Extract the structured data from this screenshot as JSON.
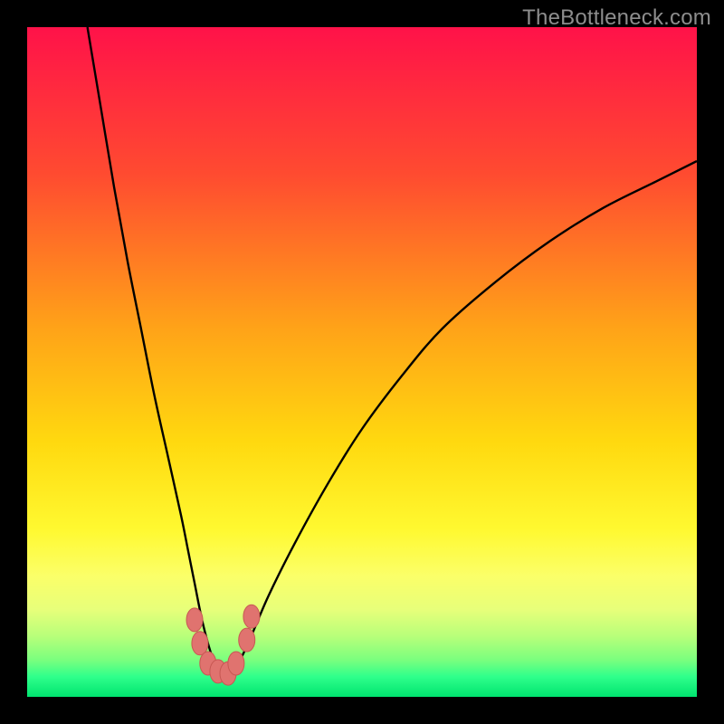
{
  "watermark": "TheBottleneck.com",
  "colors": {
    "frame": "#000000",
    "curve_stroke": "#000000",
    "marker_fill": "#e0736f",
    "marker_stroke": "#c75853",
    "gradient_stops": [
      {
        "offset": 0.0,
        "color": "#ff1249"
      },
      {
        "offset": 0.22,
        "color": "#ff4b30"
      },
      {
        "offset": 0.45,
        "color": "#ffa318"
      },
      {
        "offset": 0.62,
        "color": "#ffd90f"
      },
      {
        "offset": 0.75,
        "color": "#fff930"
      },
      {
        "offset": 0.82,
        "color": "#fbff69"
      },
      {
        "offset": 0.87,
        "color": "#e7ff7a"
      },
      {
        "offset": 0.91,
        "color": "#b7ff7a"
      },
      {
        "offset": 0.945,
        "color": "#7aff7e"
      },
      {
        "offset": 0.97,
        "color": "#2fff8b"
      },
      {
        "offset": 1.0,
        "color": "#00e46f"
      }
    ]
  },
  "chart_data": {
    "type": "line",
    "title": "",
    "xlabel": "",
    "ylabel": "",
    "xlim": [
      0,
      100
    ],
    "ylim": [
      0,
      100
    ],
    "grid": false,
    "legend_position": "none",
    "series": [
      {
        "name": "bottleneck-curve",
        "x": [
          9,
          11,
          13,
          15,
          17,
          19,
          21,
          23,
          24,
          25,
          26,
          27,
          28,
          29,
          30,
          31,
          33,
          36,
          40,
          45,
          50,
          56,
          62,
          70,
          78,
          86,
          94,
          100
        ],
        "y": [
          100,
          88,
          76,
          65,
          55,
          45,
          36,
          27,
          22,
          17,
          12,
          8,
          5,
          3.5,
          3,
          4,
          8,
          15,
          23,
          32,
          40,
          48,
          55,
          62,
          68,
          73,
          77,
          80
        ]
      }
    ],
    "markers": [
      {
        "x": 25.0,
        "y": 11.5
      },
      {
        "x": 25.8,
        "y": 8.0
      },
      {
        "x": 27.0,
        "y": 5.0
      },
      {
        "x": 28.5,
        "y": 3.8
      },
      {
        "x": 30.0,
        "y": 3.5
      },
      {
        "x": 31.2,
        "y": 5.0
      },
      {
        "x": 32.8,
        "y": 8.5
      },
      {
        "x": 33.5,
        "y": 12.0
      }
    ],
    "annotations": []
  }
}
